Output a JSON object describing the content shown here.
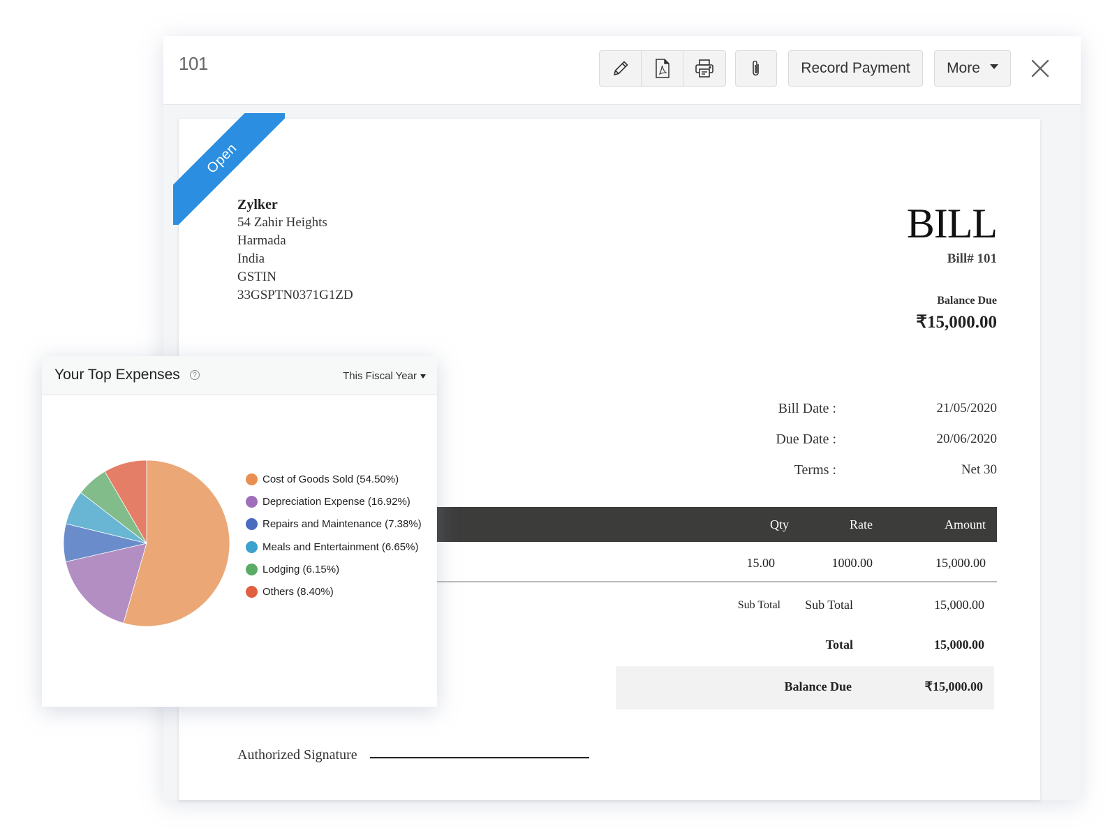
{
  "window": {
    "title": "101",
    "toolbar": {
      "icons": [
        "pencil-icon",
        "pdf-icon",
        "printer-icon",
        "paperclip-icon"
      ],
      "record_payment_label": "Record Payment",
      "more_label": "More"
    }
  },
  "bill": {
    "status_ribbon": "Open",
    "status_color": "#2b8ee0",
    "vendor": {
      "name": "Zylker",
      "address_line1": "54 Zahir Heights",
      "address_line2": "Harmada",
      "country": "India",
      "gstin_label": "GSTIN",
      "gstin": "33GSPTN0371G1ZD"
    },
    "heading": "BILL",
    "bill_number": "Bill# 101",
    "balance_due_label": "Balance Due",
    "balance_due_value": "₹15,000.00",
    "meta": [
      {
        "label": "Bill Date :",
        "value": "21/05/2020"
      },
      {
        "label": "Due Date :",
        "value": "20/06/2020"
      },
      {
        "label": "Terms :",
        "value": "Net 30"
      }
    ],
    "table": {
      "headers": {
        "qty": "Qty",
        "rate": "Rate",
        "amount": "Amount"
      },
      "rows": [
        {
          "qty": "15.00",
          "rate": "1000.00",
          "amount": "15,000.00"
        }
      ]
    },
    "totals": {
      "subtotal_small_label": "Sub Total",
      "subtotal_label": "Sub Total",
      "subtotal_value": "15,000.00",
      "total_label": "Total",
      "total_value": "15,000.00",
      "balance_label": "Balance Due",
      "balance_value": "₹15,000.00"
    },
    "signature_label": "Authorized Signature"
  },
  "expenses_widget": {
    "title": "Your Top Expenses",
    "help_glyph": "?",
    "period": "This Fiscal Year",
    "chart_data": {
      "type": "pie",
      "title": "Your Top Expenses",
      "categories": [
        "Cost of Goods Sold",
        "Depreciation Expense",
        "Repairs and Maintenance",
        "Meals and Entertainment",
        "Lodging",
        "Others"
      ],
      "values": [
        54.5,
        16.92,
        7.38,
        6.65,
        6.15,
        8.4
      ],
      "unit": "%",
      "colors": [
        "#eba776",
        "#b38ec2",
        "#6b8ccb",
        "#68b6d4",
        "#82bc8a",
        "#e47e67"
      ],
      "legend_colors": [
        "#e98f50",
        "#a06fbc",
        "#4a6cc0",
        "#3aa2cd",
        "#5aab63",
        "#e0603f"
      ],
      "legend_labels": [
        "Cost of Goods Sold (54.50%)",
        "Depreciation Expense (16.92%)",
        "Repairs and Maintenance (7.38%)",
        "Meals and Entertainment (6.65%)",
        "Lodging (6.15%)",
        "Others (8.40%)"
      ],
      "legend_position": "right",
      "start_angle": "12 o'clock",
      "direction": "clockwise"
    }
  }
}
